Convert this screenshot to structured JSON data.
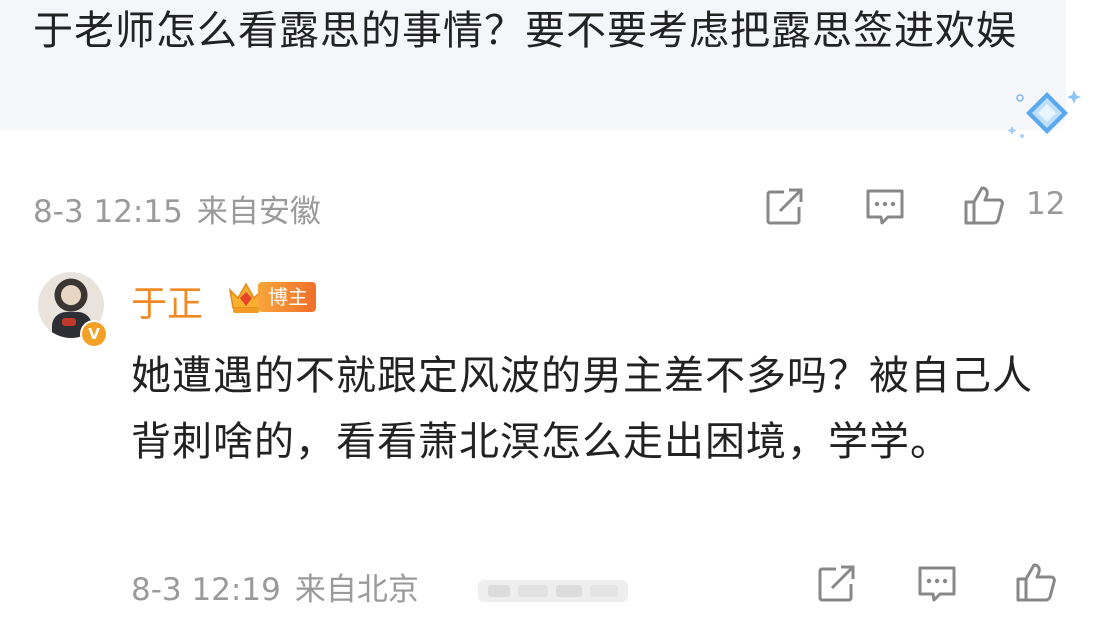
{
  "comment": {
    "text": "于老师怎么看露思的事情？要不要考虑把露思签进欢娱",
    "date": "8-3 12:15",
    "location": "来自安徽",
    "like_count": "12",
    "icons": [
      "share-icon",
      "comment-icon",
      "like-icon",
      "diamond-badge-icon"
    ]
  },
  "reply": {
    "username": "于正",
    "badge_label": "博主",
    "text": "她遭遇的不就跟定风波的男主差不多吗？被自己人背刺啥的，看看萧北溟怎么走出困境，学学。",
    "date": "8-3 12:19",
    "location": "来自北京",
    "verified_mark": "V",
    "icons": [
      "avatar",
      "crown-icon",
      "share-icon",
      "comment-icon",
      "like-icon"
    ]
  },
  "colors": {
    "bubble_bg": "#f5f6fa",
    "username": "#f08a24",
    "meta_text": "#9a9a9a",
    "body_text": "#222222",
    "badge_gradient_start": "#f7a53a",
    "badge_gradient_end": "#f26f2a"
  }
}
